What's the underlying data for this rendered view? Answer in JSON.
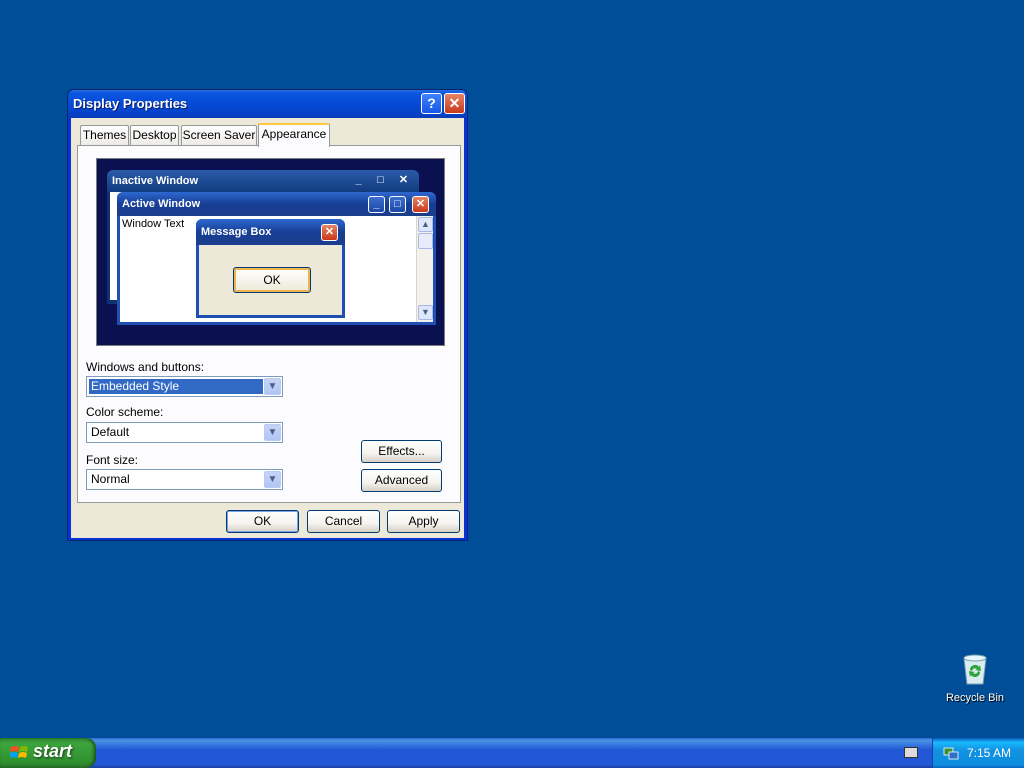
{
  "dialog": {
    "title": "Display Properties",
    "help_glyph": "?",
    "close_glyph": "✕",
    "tabs": [
      {
        "label": "Themes"
      },
      {
        "label": "Desktop"
      },
      {
        "label": "Screen Saver"
      },
      {
        "label": "Appearance",
        "active": true
      }
    ],
    "preview": {
      "inactive_title": "Inactive Window",
      "active_title": "Active Window",
      "window_text": "Window Text",
      "message_title": "Message Box",
      "message_ok": "OK",
      "min_glyph": "_",
      "max_glyph": "□",
      "close_glyph": "✕"
    },
    "windows_buttons_label": "Windows and buttons:",
    "windows_buttons_value": "Embedded Style",
    "color_scheme_label": "Color scheme:",
    "color_scheme_value": "Default",
    "font_size_label": "Font size:",
    "font_size_value": "Normal",
    "effects_button": "Effects...",
    "advanced_button": "Advanced",
    "ok_button": "OK",
    "cancel_button": "Cancel",
    "apply_button": "Apply"
  },
  "desktop": {
    "icons": [
      {
        "label": "Recycle Bin",
        "icon": "recycle-bin-icon"
      }
    ]
  },
  "taskbar": {
    "start_label": "start",
    "clock": "7:15 AM"
  },
  "colors": {
    "desktop": "#004e98",
    "titlebar": "#0649d6",
    "taskbar": "#2157d7",
    "start": "#3ca53c"
  }
}
